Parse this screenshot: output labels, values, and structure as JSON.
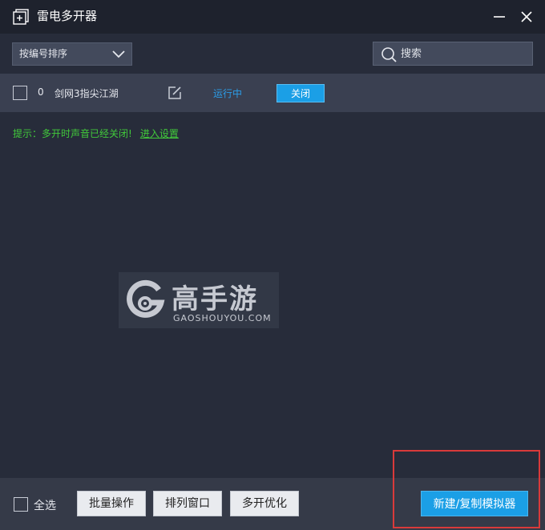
{
  "window": {
    "title": "雷电多开器"
  },
  "toolbar": {
    "sort_label": "按编号排序",
    "search_placeholder": "搜索"
  },
  "instances": [
    {
      "index": "0",
      "name": "剑网3指尖江湖",
      "status": "运行中",
      "action_label": "关闭"
    }
  ],
  "notice": {
    "text": "提示：多开时声音已经关闭!",
    "link_label": "进入设置"
  },
  "watermark": {
    "cn": "高手游",
    "en": "GAOSHOUYOU.COM"
  },
  "bottom": {
    "select_all_label": "全选",
    "batch_label": "批量操作",
    "arrange_label": "排列窗口",
    "optimize_label": "多开优化",
    "new_label": "新建/复制模拟器"
  },
  "colors": {
    "accent": "#1b9fe6",
    "status_running": "#2b9de8",
    "notice_green": "#41c93a",
    "highlight_red": "#d93a3a"
  }
}
